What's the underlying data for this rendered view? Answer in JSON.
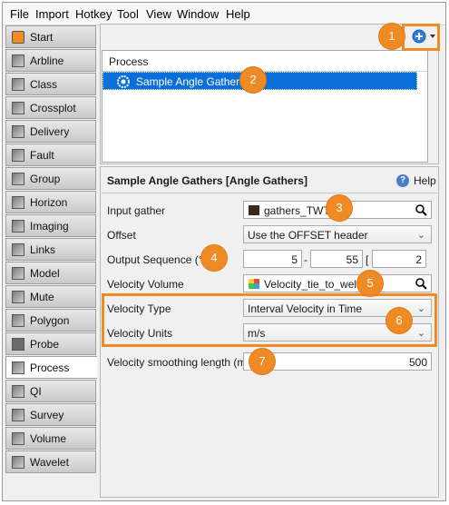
{
  "menu": [
    "File",
    "Import",
    "Hotkey",
    "Tool",
    "View",
    "Window",
    "Help"
  ],
  "sidebar": [
    {
      "label": "Start",
      "icon": "start-icon"
    },
    {
      "label": "Arbline",
      "icon": "arbline-icon"
    },
    {
      "label": "Class",
      "icon": "class-icon"
    },
    {
      "label": "Crossplot",
      "icon": "crossplot-icon"
    },
    {
      "label": "Delivery",
      "icon": "delivery-icon"
    },
    {
      "label": "Fault",
      "icon": "fault-icon"
    },
    {
      "label": "Group",
      "icon": "group-icon"
    },
    {
      "label": "Horizon",
      "icon": "horizon-icon"
    },
    {
      "label": "Imaging",
      "icon": "imaging-icon"
    },
    {
      "label": "Links",
      "icon": "links-icon"
    },
    {
      "label": "Model",
      "icon": "model-icon"
    },
    {
      "label": "Mute",
      "icon": "mute-icon"
    },
    {
      "label": "Polygon",
      "icon": "polygon-icon"
    },
    {
      "label": "Probe",
      "icon": "probe-icon"
    },
    {
      "label": "Process",
      "icon": "process-icon",
      "active": true
    },
    {
      "label": "QI",
      "icon": "qi-icon"
    },
    {
      "label": "Survey",
      "icon": "survey-icon"
    },
    {
      "label": "Volume",
      "icon": "volume-icon"
    },
    {
      "label": "Wavelet",
      "icon": "wavelet-icon"
    }
  ],
  "process_list": {
    "header": "Process",
    "rows": [
      "Sample Angle Gathers"
    ]
  },
  "form": {
    "title": "Sample Angle Gathers [Angle Gathers]",
    "help_label": "Help",
    "input_gather_label": "Input gather",
    "input_gather_value": "gathers_TWT",
    "offset_label": "Offset",
    "offset_value": "Use the OFFSET header",
    "output_sequence_label": "Output Sequence (°)",
    "output_seq_start": "5",
    "output_seq_dash": "-",
    "output_seq_end": "55",
    "output_seq_bracket": "[",
    "output_seq_step": "2",
    "velocity_volume_label": "Velocity Volume",
    "velocity_volume_value": "Velocity_tie_to_wells",
    "velocity_type_label": "Velocity Type",
    "velocity_type_value": "Interval Velocity in Time",
    "velocity_units_label": "Velocity Units",
    "velocity_units_value": "m/s",
    "smoothing_label": "Velocity smoothing length (ms)",
    "smoothing_value": "500"
  },
  "callouts": [
    "1",
    "2",
    "3",
    "4",
    "5",
    "6",
    "7"
  ],
  "colors": {
    "accent": "#f08a24",
    "selection": "#0a6fd8"
  }
}
